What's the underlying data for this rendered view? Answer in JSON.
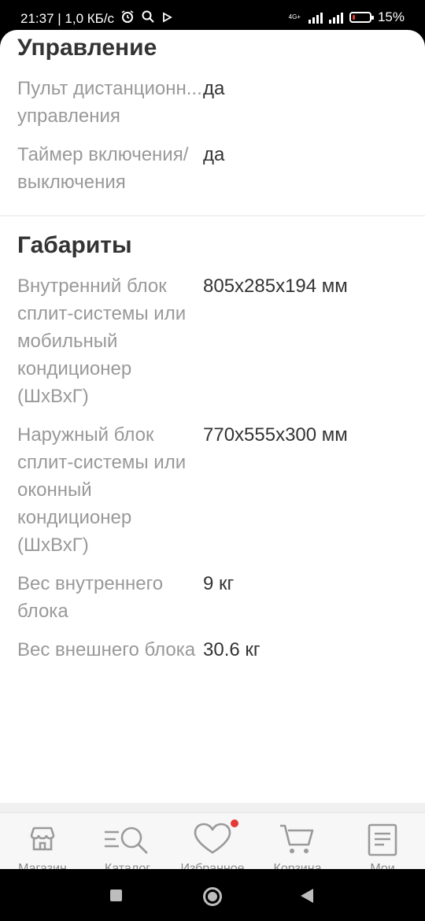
{
  "status_bar": {
    "time_speed": "21:37 | 1,0 КБ/с",
    "network_type": "4G+",
    "battery": "15%",
    "battery_level": 0.15
  },
  "sections": [
    {
      "title": "Управление",
      "rows": [
        {
          "label": "Пульт дистанционн... управления",
          "value": "да"
        },
        {
          "label": "Таймер включения/ выключения",
          "value": "да"
        }
      ]
    },
    {
      "title": "Габариты",
      "rows": [
        {
          "label": "Внутренний блок сплит-системы или мобильный кондиционер (ШхВхГ)",
          "value": "805x285x194 мм"
        },
        {
          "label": "Наружный блок сплит-системы или оконный кондиционер (ШхВхГ)",
          "value": "770x555x300 мм"
        },
        {
          "label": "Вес внутреннего блока",
          "value": "9 кг"
        },
        {
          "label": "Вес внешнего блока",
          "value": "30.6 кг"
        }
      ]
    }
  ],
  "bottom_nav": {
    "items": [
      {
        "label": "Магазин",
        "icon": "store-icon"
      },
      {
        "label": "Каталог",
        "icon": "catalog-search-icon"
      },
      {
        "label": "Избранное",
        "icon": "heart-icon",
        "has_badge": true
      },
      {
        "label": "Корзина",
        "icon": "cart-icon"
      },
      {
        "label": "Мои",
        "icon": "orders-icon"
      }
    ]
  },
  "colors": {
    "accent": "#e53935",
    "label_gray": "#999999",
    "text_dark": "#333333",
    "nav_icon": "#9a9a9a"
  }
}
